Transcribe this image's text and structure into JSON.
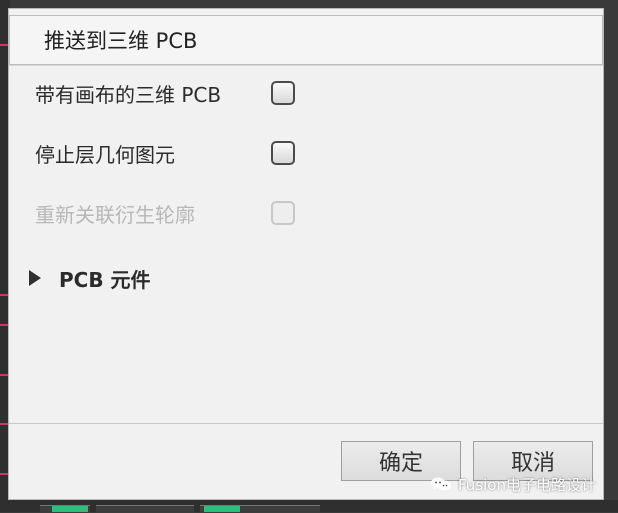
{
  "dialog": {
    "title": "推送到三维 PCB",
    "options": [
      {
        "label": "带有画布的三维 PCB",
        "checked": false,
        "enabled": true
      },
      {
        "label": "停止层几何图元",
        "checked": false,
        "enabled": true
      },
      {
        "label": "重新关联衍生轮廓",
        "checked": false,
        "enabled": false
      }
    ],
    "section": {
      "label": "PCB 元件",
      "expanded": false,
      "icon": "triangle-right-icon"
    },
    "buttons": {
      "ok": "确定",
      "cancel": "取消"
    }
  },
  "watermark": {
    "text": "Fusion电子电路设计",
    "icon": "wechat-icon"
  },
  "colors": {
    "dialog_bg": "#f1f1f1",
    "text": "#2b2b2b",
    "disabled_text": "#b7b7b7",
    "bg_accent_pink": "#d2336b",
    "bg_accent_green": "#2bbf7b"
  }
}
